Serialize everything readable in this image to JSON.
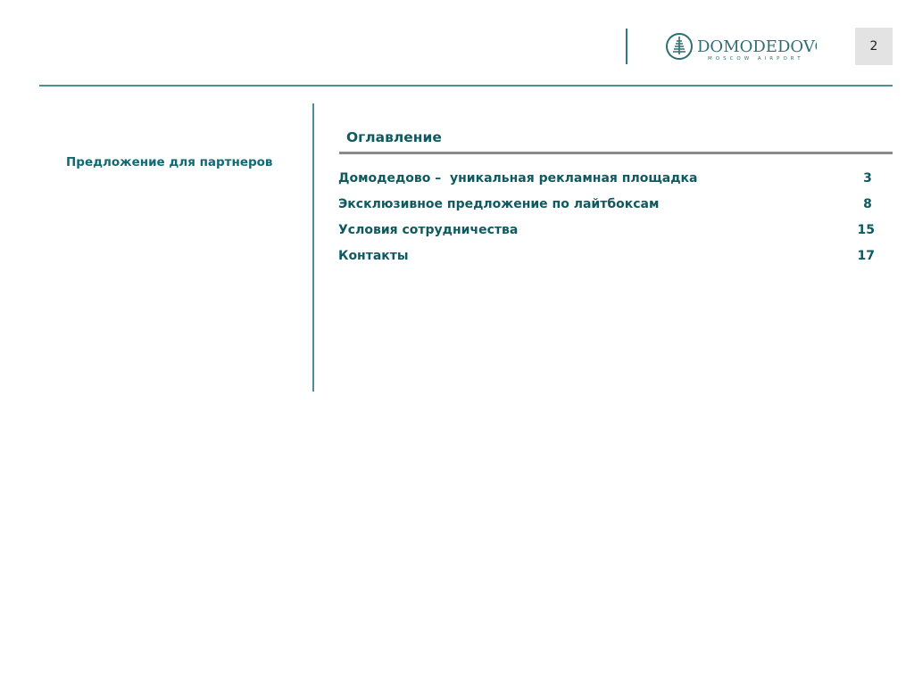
{
  "header": {
    "logo": {
      "name": "DOMODEDOVO",
      "subtitle": "MOSCOW AIRPORT",
      "icon": "domodedovo-tower-icon",
      "color": "#2e6f73"
    },
    "page_number": "2"
  },
  "sidebar": {
    "section_label": "Предложение для партнеров"
  },
  "toc": {
    "heading": "Оглавление",
    "items": [
      {
        "title": "Домодедово –  уникальная рекламная площадка",
        "page": "3"
      },
      {
        "title": "Эксклюзивное предложение по лайтбоксам",
        "page": "8"
      },
      {
        "title": "Условия сотрудничества",
        "page": "15"
      },
      {
        "title": "Контакты",
        "page": "17"
      }
    ]
  },
  "colors": {
    "accent": "#0f6a73",
    "rule": "#4b8f94",
    "heading_rule": "#8a8a8a",
    "page_badge_bg": "#e3e3e3"
  }
}
